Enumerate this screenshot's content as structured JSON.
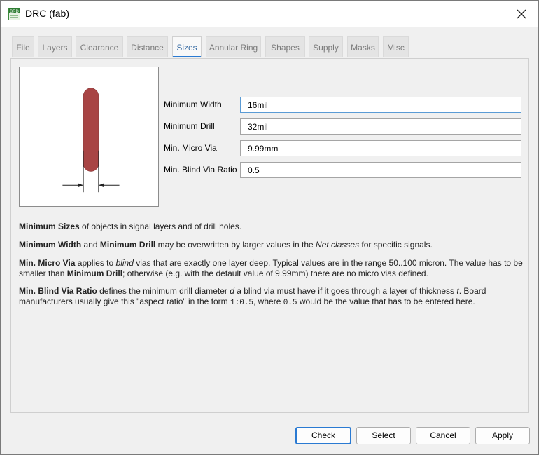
{
  "window": {
    "title": "DRC (fab)",
    "app_icon_text": "BRD"
  },
  "tabs": [
    {
      "label": "File"
    },
    {
      "label": "Layers"
    },
    {
      "label": "Clearance"
    },
    {
      "label": "Distance"
    },
    {
      "label": "Sizes"
    },
    {
      "label": "Annular Ring"
    },
    {
      "label": "Shapes"
    },
    {
      "label": "Supply"
    },
    {
      "label": "Masks"
    },
    {
      "label": "Misc"
    }
  ],
  "active_tab": "Sizes",
  "fields": [
    {
      "label": "Minimum Width",
      "value": "16mil"
    },
    {
      "label": "Minimum Drill",
      "value": "32mil"
    },
    {
      "label": "Min. Micro Via",
      "value": "9.99mm"
    },
    {
      "label": "Min. Blind Via Ratio",
      "value": "0.5"
    }
  ],
  "description": {
    "p1": {
      "b1": "Minimum Sizes",
      "t1": " of objects in signal layers and of drill holes."
    },
    "p2": {
      "b1": "Minimum Width",
      "t1": " and ",
      "b2": "Minimum Drill",
      "t2": " may be overwritten by larger values in the ",
      "i1": "Net classes",
      "t3": " for specific signals."
    },
    "p3": {
      "b1": "Min. Micro Via",
      "t1": " applies to ",
      "i1": "blind",
      "t2": " vias that are exactly one layer deep. Typical values are in the range 50..100 micron. The value has to be smaller than ",
      "b2": "Minimum Drill",
      "t3": "; otherwise (e.g. with the default value of 9.99mm) there are no micro vias defined."
    },
    "p4": {
      "b1": "Min. Blind Via Ratio",
      "t1": " defines the minimum drill diameter ",
      "i1": "d",
      "t2": " a blind via must have if it goes through a layer of thickness ",
      "i2": "t",
      "t3": ". Board manufacturers usually give this \"aspect ratio\" in the form ",
      "m1": "1:0.5",
      "t4": ", where ",
      "m2": "0.5",
      "t5": " would be the value that has to be entered here."
    }
  },
  "buttons": {
    "check": "Check",
    "select": "Select",
    "cancel": "Cancel",
    "apply": "Apply"
  },
  "colors": {
    "accent": "#2a7ad2",
    "trace": "#a84444"
  }
}
